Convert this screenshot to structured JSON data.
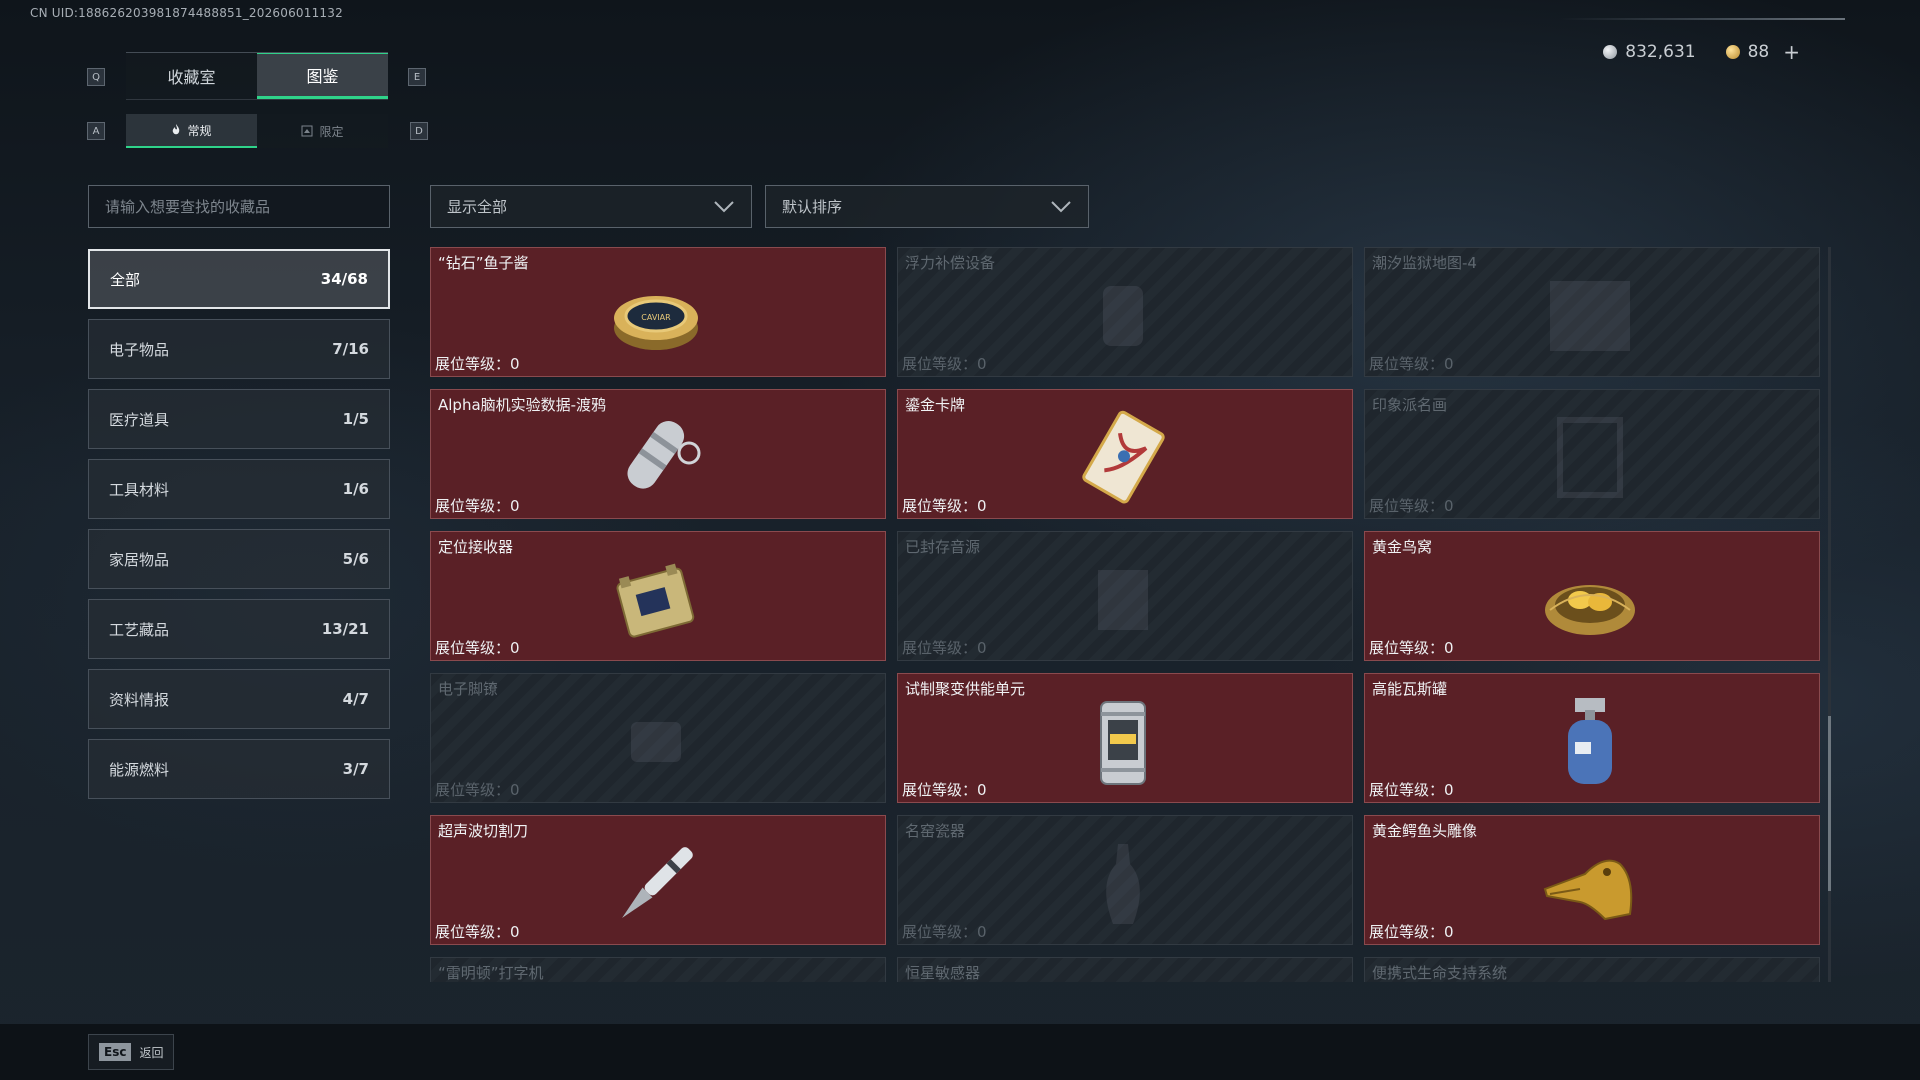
{
  "uid": "CN UID:188626203981874488851_202606011132",
  "key_hints": {
    "q": "Q",
    "e": "E",
    "a": "A",
    "d": "D"
  },
  "tabs": [
    {
      "label": "收藏室"
    },
    {
      "label": "图鉴"
    }
  ],
  "subtabs": [
    {
      "label": "常规"
    },
    {
      "label": "限定"
    }
  ],
  "currency": {
    "silver": "832,631",
    "gold": "88",
    "plus": "+"
  },
  "search": {
    "placeholder": "请输入想要查找的收藏品"
  },
  "filters": {
    "show": "显示全部",
    "sort": "默认排序"
  },
  "categories": [
    {
      "label": "全部",
      "count": "34/68"
    },
    {
      "label": "电子物品",
      "count": "7/16"
    },
    {
      "label": "医疗道具",
      "count": "1/5"
    },
    {
      "label": "工具材料",
      "count": "1/6"
    },
    {
      "label": "家居物品",
      "count": "5/6"
    },
    {
      "label": "工艺藏品",
      "count": "13/21"
    },
    {
      "label": "资料情报",
      "count": "4/7"
    },
    {
      "label": "能源燃料",
      "count": "3/7"
    }
  ],
  "items": [
    {
      "name": "“钻石”鱼子酱",
      "level": "展位等级：0",
      "owned": true,
      "icon": "caviar-tin-icon"
    },
    {
      "name": "浮力补偿设备",
      "level": "展位等级：0",
      "owned": false,
      "icon": "buoyancy-device-icon"
    },
    {
      "name": "潮汐监狱地图-4",
      "level": "展位等级：0",
      "owned": false,
      "icon": "map-icon"
    },
    {
      "name": "Alpha脑机实验数据-渡鸦",
      "level": "展位等级：0",
      "owned": true,
      "icon": "data-capsule-icon"
    },
    {
      "name": "鎏金卡牌",
      "level": "展位等级：0",
      "owned": true,
      "icon": "gilded-card-icon"
    },
    {
      "name": "印象派名画",
      "level": "展位等级：0",
      "owned": false,
      "icon": "painting-icon"
    },
    {
      "name": "定位接收器",
      "level": "展位等级：0",
      "owned": true,
      "icon": "receiver-icon"
    },
    {
      "name": "已封存音源",
      "level": "展位等级：0",
      "owned": false,
      "icon": "sealed-audio-icon"
    },
    {
      "name": "黄金鸟窝",
      "level": "展位等级：0",
      "owned": true,
      "icon": "golden-nest-icon"
    },
    {
      "name": "电子脚镣",
      "level": "展位等级：0",
      "owned": false,
      "icon": "ankle-monitor-icon"
    },
    {
      "name": "试制聚变供能单元",
      "level": "展位等级：0",
      "owned": true,
      "icon": "fusion-cell-icon"
    },
    {
      "name": "高能瓦斯罐",
      "level": "展位等级：0",
      "owned": true,
      "icon": "gas-canister-icon"
    },
    {
      "name": "超声波切割刀",
      "level": "展位等级：0",
      "owned": true,
      "icon": "ultrasonic-knife-icon"
    },
    {
      "name": "名窑瓷器",
      "level": "展位等级：0",
      "owned": false,
      "icon": "porcelain-vase-icon"
    },
    {
      "name": "黄金鳄鱼头雕像",
      "level": "展位等级：0",
      "owned": true,
      "icon": "golden-crocodile-icon"
    },
    {
      "name": "“雷明顿”打字机",
      "owned": false,
      "icon": "typewriter-icon"
    },
    {
      "name": "恒星敏感器",
      "owned": false,
      "icon": "star-sensor-icon"
    },
    {
      "name": "便携式生命支持系统",
      "owned": false,
      "icon": "life-support-icon"
    }
  ],
  "footer": {
    "esc_key": "Esc",
    "esc_label": "返回"
  },
  "colors": {
    "accent": "#2fd38a",
    "owned_card": "#5a2026",
    "locked_card": "#1f262d"
  }
}
